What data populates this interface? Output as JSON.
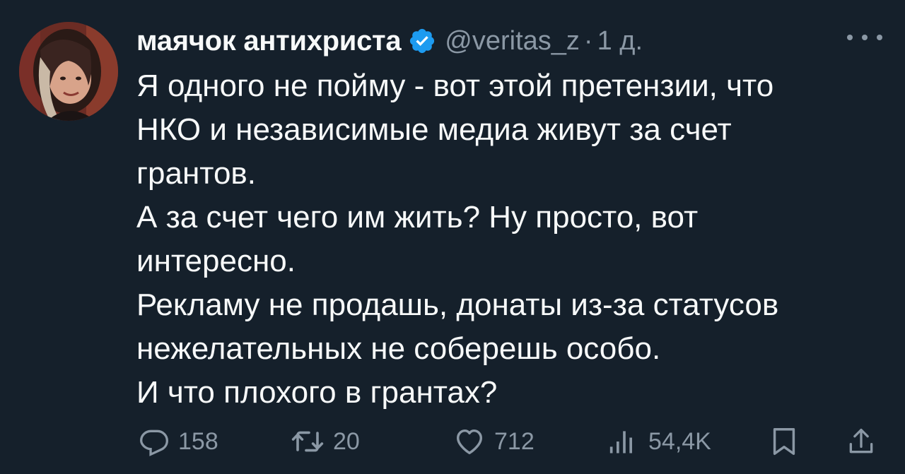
{
  "tweet": {
    "author": {
      "display_name": "маячок антихриста",
      "handle": "@veritas_z",
      "verified": true,
      "avatar_icon": "user-avatar"
    },
    "separator": "·",
    "time": "1 д.",
    "more_icon": "more-horizontal-icon",
    "text_lines": [
      "Я одного не пойму - вот этой претензии, что",
      "НКО и независимые медиа живут за счет",
      "грантов.",
      "А за счет чего им жить? Ну просто, вот",
      "интересно.",
      "Рекламу не продашь, донаты из-за статусов",
      "нежелательных не соберешь особо.",
      "И что плохого в грантах?"
    ],
    "actions": {
      "reply": {
        "icon": "reply-icon",
        "count": "158"
      },
      "retweet": {
        "icon": "retweet-icon",
        "count": "20"
      },
      "like": {
        "icon": "like-icon",
        "count": "712"
      },
      "views": {
        "icon": "views-icon",
        "count": "54,4K"
      },
      "bookmark": {
        "icon": "bookmark-icon"
      },
      "share": {
        "icon": "share-icon"
      }
    }
  },
  "colors": {
    "background": "#15202b",
    "text": "#f7f9f9",
    "secondary": "#8b98a5",
    "verified": "#1d9bf0"
  }
}
